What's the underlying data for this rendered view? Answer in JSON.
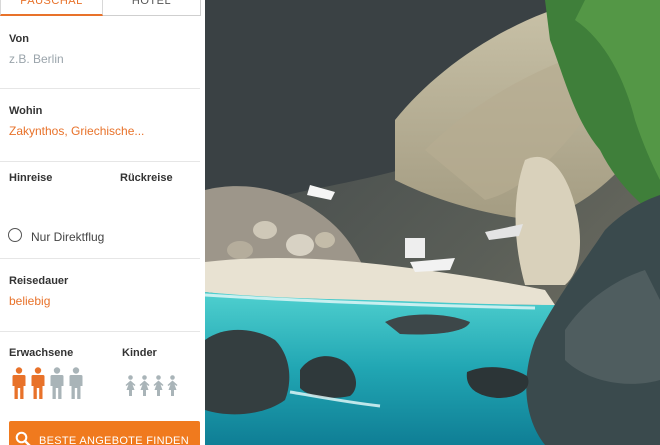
{
  "tabs": {
    "pauschal": "PAUSCHAL",
    "hotel": "HOTEL"
  },
  "form": {
    "from_label": "Von",
    "from_placeholder": "z.B. Berlin",
    "to_label": "Wohin",
    "to_value": "Zakynthos, Griechische...",
    "departure_label": "Hinreise",
    "return_label": "Rückreise",
    "direct_flight_label": "Nur Direktflug",
    "duration_label": "Reisedauer",
    "duration_value": "beliebig",
    "adults_label": "Erwachsene",
    "children_label": "Kinder",
    "adults_selected": 2,
    "adults_total": 4,
    "children_selected": 0,
    "children_total": 4,
    "cta_label": "BESTE ANGEBOTE FINDEN"
  },
  "icons": {
    "adult": "person-icon",
    "child": "child-icon",
    "search": "search-icon",
    "radio": "radio-unchecked-icon"
  },
  "colors": {
    "accent": "#e8722a",
    "cta": "#f07a1e",
    "inactive_person": "#a9b4b8"
  },
  "hero_image": "coastal cove with turquoise sea, rocky cliffs and small boats on a pebble beach"
}
